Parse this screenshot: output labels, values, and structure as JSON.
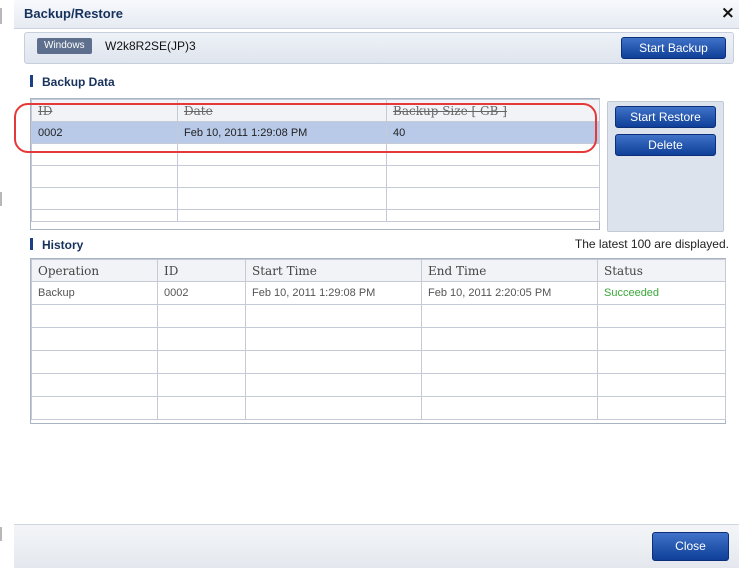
{
  "dialog": {
    "title": "Backup/Restore",
    "close_glyph": "×",
    "close_icon": "close-icon"
  },
  "server": {
    "os_badge": "Windows",
    "name": "W2k8R2SE(JP)3",
    "start_backup_label": "Start Backup"
  },
  "backup_data": {
    "heading": "Backup Data",
    "columns": [
      "ID",
      "Date",
      "Backup Size [ GB ]"
    ],
    "rows": [
      {
        "id": "0002",
        "date": "Feb 10, 2011 1:29:08 PM",
        "size": "40"
      }
    ],
    "start_restore_label": "Start Restore",
    "delete_label": "Delete"
  },
  "history": {
    "heading": "History",
    "note": "The latest 100 are displayed.",
    "columns": [
      "Operation",
      "ID",
      "Start Time",
      "End Time",
      "Status"
    ],
    "rows": [
      {
        "operation": "Backup",
        "id": "0002",
        "start": "Feb 10, 2011 1:29:08 PM",
        "end": "Feb 10, 2011 2:20:05 PM",
        "status": "Succeeded"
      }
    ]
  },
  "footer": {
    "close_label": "Close"
  },
  "colors": {
    "accent": "#0f3f98",
    "title": "#16315c",
    "selected_row": "#b9cae8",
    "success": "#3aa83a",
    "highlight_ring": "#e53838"
  }
}
